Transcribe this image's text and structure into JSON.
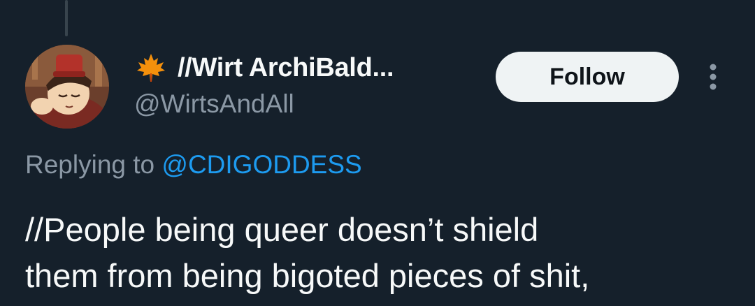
{
  "author": {
    "display_name": "//Wirt ArchiBald...",
    "handle": "@WirtsAndAll",
    "name_emoji": "maple-leaf-icon",
    "avatar": "avatar-illustration"
  },
  "actions": {
    "follow_label": "Follow",
    "more_icon": "more-vertical-icon"
  },
  "reply": {
    "prefix": "Replying to",
    "mention": "@CDIGODDESS"
  },
  "tweet": {
    "lines": [
      "//People being queer doesn’t shield",
      "them from being bigoted pieces of shit,"
    ]
  },
  "colors": {
    "background": "#15202b",
    "primary_text": "#f7f9f9",
    "secondary_text": "#8b98a5",
    "link": "#1d9bf0",
    "follow_bg": "#eff3f4",
    "leaf": "#f4900c"
  }
}
